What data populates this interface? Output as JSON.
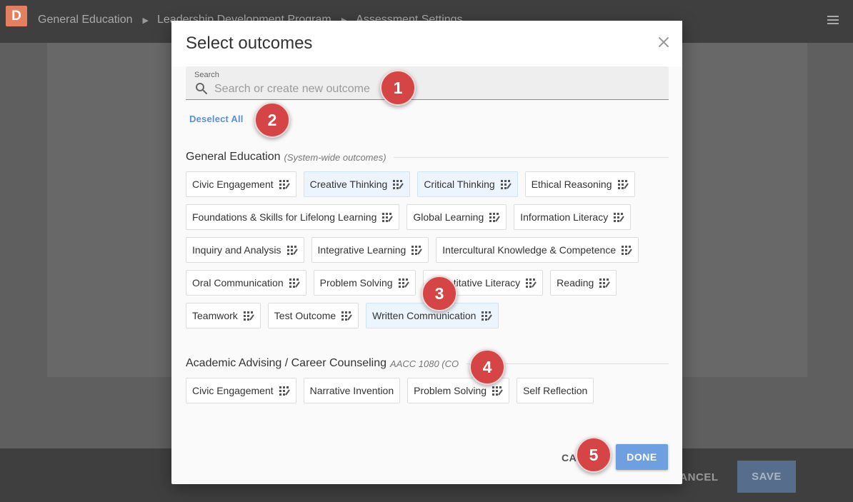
{
  "app": {
    "logo": "D",
    "breadcrumb": [
      "General Education",
      "Leadership Development Program",
      "Assessment Settings"
    ],
    "footer": {
      "cancel_label": "CANCEL",
      "save_label": "SAVE"
    }
  },
  "modal": {
    "title": "Select outcomes",
    "search": {
      "label": "Search",
      "placeholder": "Search or create new outcome",
      "value": ""
    },
    "deselect_all_label": "Deselect All",
    "groups": [
      {
        "title": "General Education",
        "subtitle": "(System-wide outcomes)",
        "items": [
          {
            "label": "Civic Engagement",
            "selected": false,
            "has_rubric": true
          },
          {
            "label": "Creative Thinking",
            "selected": true,
            "has_rubric": true
          },
          {
            "label": "Critical Thinking",
            "selected": true,
            "has_rubric": true
          },
          {
            "label": "Ethical Reasoning",
            "selected": false,
            "has_rubric": true
          },
          {
            "label": "Foundations & Skills for Lifelong Learning",
            "selected": false,
            "has_rubric": true
          },
          {
            "label": "Global Learning",
            "selected": false,
            "has_rubric": true
          },
          {
            "label": "Information Literacy",
            "selected": false,
            "has_rubric": true
          },
          {
            "label": "Inquiry and Analysis",
            "selected": false,
            "has_rubric": true
          },
          {
            "label": "Integrative Learning",
            "selected": false,
            "has_rubric": true
          },
          {
            "label": "Intercultural Knowledge & Competence",
            "selected": false,
            "has_rubric": true
          },
          {
            "label": "Oral Communication",
            "selected": false,
            "has_rubric": true
          },
          {
            "label": "Problem Solving",
            "selected": false,
            "has_rubric": true
          },
          {
            "label": "Quantitative Literacy",
            "selected": false,
            "has_rubric": true
          },
          {
            "label": "Reading",
            "selected": false,
            "has_rubric": true
          },
          {
            "label": "Teamwork",
            "selected": false,
            "has_rubric": true
          },
          {
            "label": "Test Outcome",
            "selected": false,
            "has_rubric": true
          },
          {
            "label": "Written Communication",
            "selected": true,
            "has_rubric": true
          }
        ]
      },
      {
        "title": "Academic Advising / Career Counseling",
        "subtitle": "AACC 1080 (CO",
        "items": [
          {
            "label": "Civic Engagement",
            "selected": false,
            "has_rubric": true
          },
          {
            "label": "Narrative Invention",
            "selected": false,
            "has_rubric": false
          },
          {
            "label": "Problem Solving",
            "selected": false,
            "has_rubric": true
          },
          {
            "label": "Self Reflection",
            "selected": false,
            "has_rubric": false
          }
        ]
      }
    ],
    "cancel_label": "CA",
    "done_label": "DONE"
  },
  "callouts": [
    "1",
    "2",
    "3",
    "4",
    "5"
  ],
  "icons": {
    "close": "close-icon",
    "search": "search-icon",
    "rubric": "rubric-grid-icon",
    "menu": "hamburger-menu-icon"
  },
  "colors": {
    "accent": "#6e9fde",
    "link": "#5b8ed6",
    "selected_chip": "#ecf5fd",
    "badge": "#d64545"
  }
}
